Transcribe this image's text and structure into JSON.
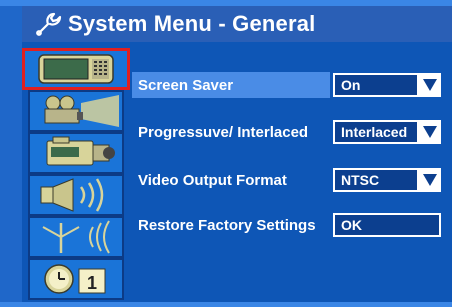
{
  "header": {
    "title": "System Menu - General",
    "icon": "wrench-icon"
  },
  "sidebar": {
    "items": [
      {
        "name": "tv-icon",
        "selected": true
      },
      {
        "name": "projector-icon",
        "selected": false
      },
      {
        "name": "camcorder-icon",
        "selected": false
      },
      {
        "name": "speaker-icon",
        "selected": false
      },
      {
        "name": "antenna-icon",
        "selected": false
      },
      {
        "name": "clock-icon",
        "selected": false
      }
    ]
  },
  "menu": {
    "rows": [
      {
        "label": "Screen Saver",
        "value": "On",
        "has_dropdown": true,
        "selected": true
      },
      {
        "label": "Progressuve/ Interlaced",
        "value": "Interlaced",
        "has_dropdown": true,
        "selected": false
      },
      {
        "label": "Video Output Format",
        "value": "NTSC",
        "has_dropdown": true,
        "selected": false
      },
      {
        "label": "Restore Factory Settings",
        "value": "OK",
        "has_dropdown": false,
        "selected": false
      }
    ]
  },
  "colors": {
    "background": "#1f67c9",
    "header": "#2a5fb6",
    "selection_highlight": "#4a8ce6",
    "value_box": "#0c3f8f",
    "sidebar_selected_outline": "#e02020"
  }
}
